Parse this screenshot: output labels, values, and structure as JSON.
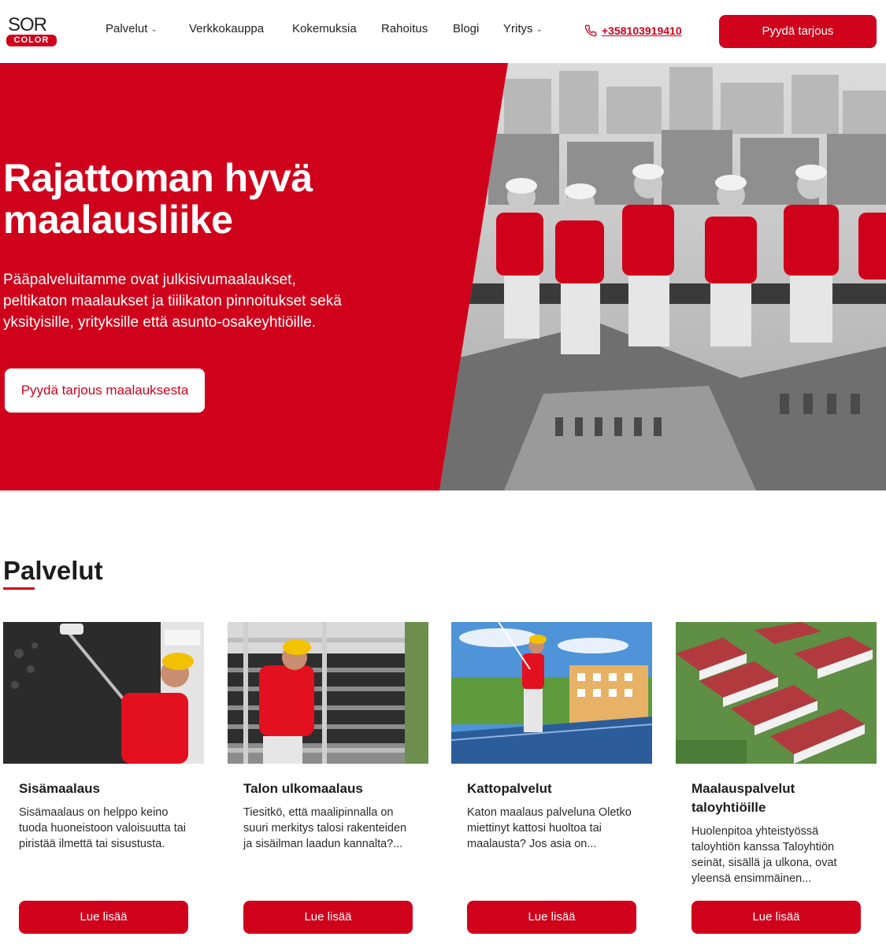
{
  "header": {
    "logo": {
      "top": "SOR",
      "bottom": "COLOR"
    },
    "nav": [
      {
        "label": "Palvelut",
        "dropdown": true
      },
      {
        "label": "Verkkokauppa",
        "dropdown": false
      },
      {
        "label": "Kokemuksia",
        "dropdown": false
      },
      {
        "label": "Rahoitus",
        "dropdown": false
      },
      {
        "label": "Blogi",
        "dropdown": false
      },
      {
        "label": "Yritys",
        "dropdown": true
      }
    ],
    "phone": "+358103919410",
    "cta": "Pyydä tarjous"
  },
  "hero": {
    "title": "Rajattoman hyvä maalausliike",
    "text": "Pääpalveluitamme ovat julkisivumaalaukset, peltikaton maalaukset ja tiilikaton pinnoitukset sekä yksityisille, yrityksille että asunto-osakeyhtiöille.",
    "cta": "Pyydä tarjous maalauksesta"
  },
  "services": {
    "title": "Palvelut",
    "cards": [
      {
        "title": "Sisämaalaus",
        "text": "Sisämaalaus on helppo keino tuoda huoneistoon valoisuutta tai piristää ilmettä tai sisustusta.",
        "button": "Lue lisää"
      },
      {
        "title": "Talon ulkomaalaus",
        "text": "Tiesitkö, että maalipinnalla on suuri merkitys talosi rakenteiden ja sisäilman laadun kannalta?...",
        "button": "Lue lisää"
      },
      {
        "title": "Kattopalvelut",
        "text": "Katon maalaus palveluna Oletko miettinyt kattosi huoltoa tai maalausta? Jos asia on...",
        "button": "Lue lisää"
      },
      {
        "title": "Maalauspalvelut taloyhtiöille",
        "text": "Huolenpitoa yhteistyössä taloyhtiön kanssa Taloyhtiön seinät, sisällä ja ulkona, ovat yleensä ensimmäinen...",
        "button": "Lue lisää"
      }
    ]
  },
  "colors": {
    "brand_red": "#d0021b",
    "text_dark": "#1c1c1c",
    "white": "#ffffff"
  }
}
